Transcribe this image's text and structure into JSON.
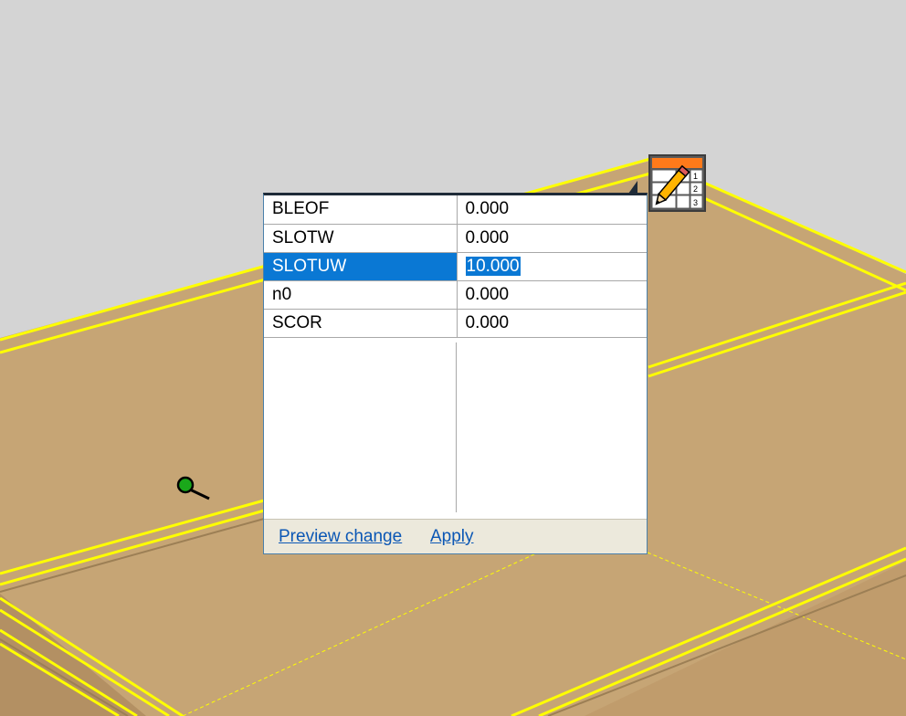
{
  "parameters": [
    {
      "name": "BLEOF",
      "value": "0.000",
      "selected": false
    },
    {
      "name": "SLOTW",
      "value": "0.000",
      "selected": false
    },
    {
      "name": "SLOTUW",
      "value": "10.000",
      "selected": true
    },
    {
      "name": "n0",
      "value": "0.000",
      "selected": false
    },
    {
      "name": "SCOR",
      "value": "0.000",
      "selected": false
    }
  ],
  "footer": {
    "preview_label": "Preview change",
    "apply_label": "Apply"
  },
  "icons": {
    "editor_toggle": "table-pencil-icon",
    "cursor": "magnifier-cursor-icon"
  },
  "colors": {
    "selection": "#0a78d4",
    "link": "#0b57b5",
    "edge_highlight": "#ffff00",
    "surface": "#c6a575",
    "background": "#d4d4d4"
  }
}
